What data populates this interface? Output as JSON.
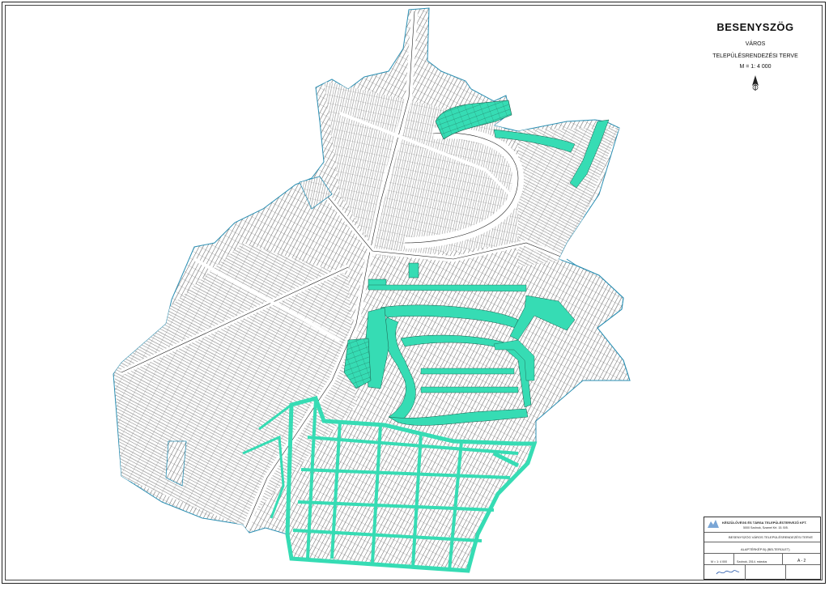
{
  "title": {
    "name": "BESENYSZÖG",
    "type": "VÁROS",
    "plan": "TELEPÜLÉSRENDEZÉSI TERVE",
    "scale": "M = 1: 4 000"
  },
  "legend": {
    "company": "KÉSZÜLŐVÉGS ÉS TÁRSA TELEPÜLÉSTERVEZŐ KFT.",
    "address": "5000 Szolnok, Szamel Krt. 15. B/5.",
    "plan_name": "BESENYSZÖG VÁROS TELEPÜLÉSRENDEZÉSI TERVE",
    "sheet_title": "ALAPTÉRKÉP B) (BELTERÜLET)",
    "scale_value": "M = 1: 4 000",
    "date_value": "Szolnok, 2014. március",
    "sheet_code": "A - 2"
  },
  "map": {
    "highlight_color": "#36dcb4",
    "line_color": "#1a1a1a",
    "outline_color": "#2b8fb3"
  }
}
